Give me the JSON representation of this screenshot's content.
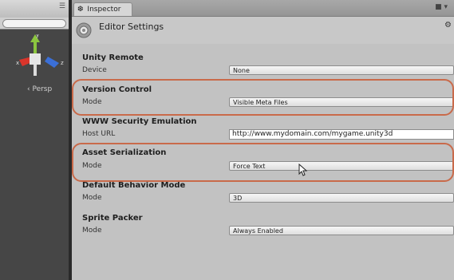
{
  "scene": {
    "persp_label": "‹ Persp",
    "gizmo_axes": {
      "y": "y",
      "x": "x",
      "z": "z"
    }
  },
  "inspector": {
    "tab_label": "Inspector",
    "title": "Editor Settings",
    "sections": [
      {
        "title": "Unity Remote",
        "rows": [
          {
            "label": "Device",
            "value": "None",
            "kind": "dropdown"
          }
        ]
      },
      {
        "title": "Version Control",
        "rows": [
          {
            "label": "Mode",
            "value": "Visible Meta Files",
            "kind": "dropdown"
          }
        ]
      },
      {
        "title": "WWW Security Emulation",
        "rows": [
          {
            "label": "Host URL",
            "value": "http://www.mydomain.com/mygame.unity3d",
            "kind": "text"
          }
        ]
      },
      {
        "title": "Asset Serialization",
        "rows": [
          {
            "label": "Mode",
            "value": "Force Text",
            "kind": "dropdown"
          }
        ]
      },
      {
        "title": "Default Behavior Mode",
        "rows": [
          {
            "label": "Mode",
            "value": "3D",
            "kind": "dropdown"
          }
        ]
      },
      {
        "title": "Sprite Packer",
        "rows": [
          {
            "label": "Mode",
            "value": "Always Enabled",
            "kind": "dropdown"
          }
        ]
      }
    ]
  },
  "highlighted_sections": [
    "Version Control",
    "Asset Serialization"
  ],
  "colors": {
    "highlight": "#c96a4a",
    "gizmo_y": "#8cc63f",
    "gizmo_x": "#d9352b",
    "gizmo_z": "#3b6fd6"
  }
}
